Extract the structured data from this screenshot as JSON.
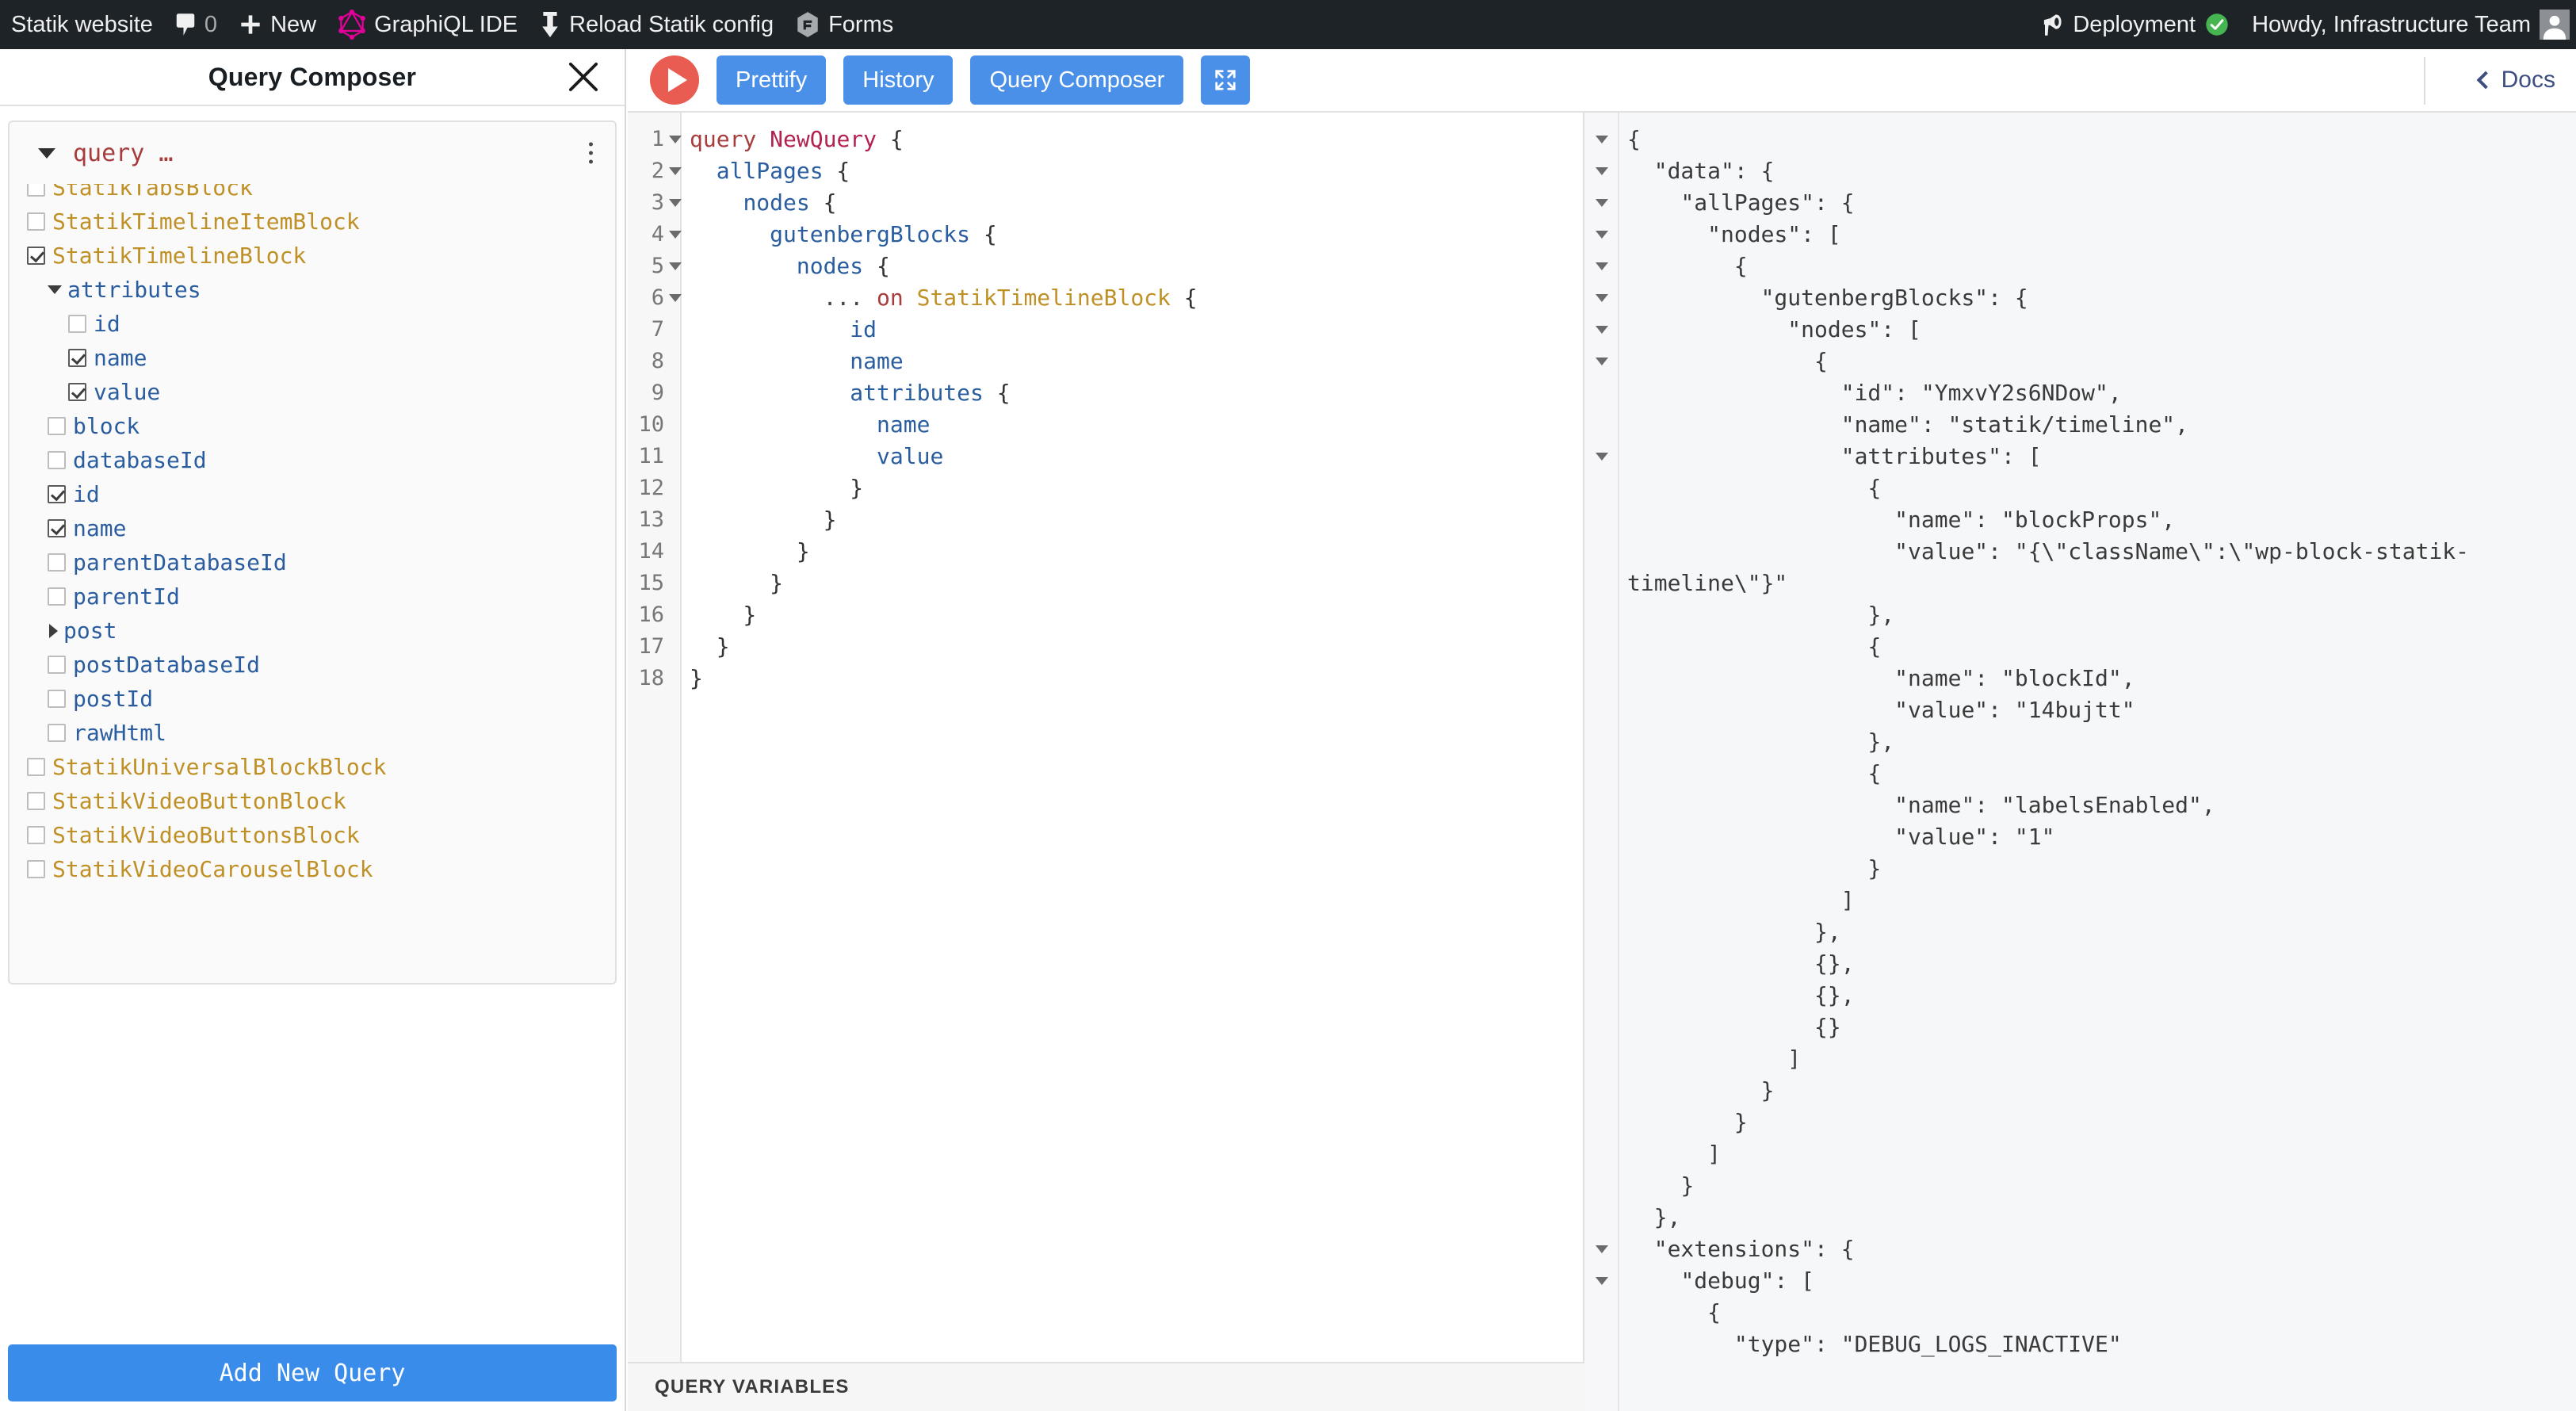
{
  "adminbar": {
    "site_name": "Statik website",
    "comments_icon": "comment-bubble-icon",
    "comments_count": "0",
    "new_icon": "plus-icon",
    "new_label": "New",
    "graphiql_icon": "graphql-logo-icon",
    "graphiql_label": "GraphiQL IDE",
    "reload_icon": "download-arrow-icon",
    "reload_label": "Reload Statik config",
    "forms_icon": "gravity-forms-icon",
    "forms_label": "Forms",
    "deployment_icon": "megaphone-icon",
    "deployment_label": "Deployment",
    "deployment_status_icon": "check-circle-icon",
    "howdy_label": "Howdy, Infrastructure Team",
    "avatar": "user-avatar"
  },
  "composer": {
    "title": "Query Composer",
    "close_icon": "close-icon",
    "query_operation_name": "query …",
    "kebab_icon": "more-options-icon",
    "add_new_query_label": "Add New Query",
    "tree": [
      {
        "label": "StatikTabsBlock",
        "kind": "type",
        "indent": 0,
        "checked": false,
        "clipped": true
      },
      {
        "label": "StatikTimelineItemBlock",
        "kind": "type",
        "indent": 0,
        "checked": false
      },
      {
        "label": "StatikTimelineBlock",
        "kind": "type",
        "indent": 0,
        "checked": true
      },
      {
        "label": "attributes",
        "kind": "field",
        "indent": 1,
        "toggle": "down"
      },
      {
        "label": "id",
        "kind": "field",
        "indent": 2,
        "checked": false
      },
      {
        "label": "name",
        "kind": "field",
        "indent": 2,
        "checked": true
      },
      {
        "label": "value",
        "kind": "field",
        "indent": 2,
        "checked": true
      },
      {
        "label": "block",
        "kind": "field",
        "indent": 1,
        "checked": false
      },
      {
        "label": "databaseId",
        "kind": "field",
        "indent": 1,
        "checked": false
      },
      {
        "label": "id",
        "kind": "field",
        "indent": 1,
        "checked": true
      },
      {
        "label": "name",
        "kind": "field",
        "indent": 1,
        "checked": true
      },
      {
        "label": "parentDatabaseId",
        "kind": "field",
        "indent": 1,
        "checked": false
      },
      {
        "label": "parentId",
        "kind": "field",
        "indent": 1,
        "checked": false
      },
      {
        "label": "post",
        "kind": "field",
        "indent": 1,
        "toggle": "right"
      },
      {
        "label": "postDatabaseId",
        "kind": "field",
        "indent": 1,
        "checked": false
      },
      {
        "label": "postId",
        "kind": "field",
        "indent": 1,
        "checked": false
      },
      {
        "label": "rawHtml",
        "kind": "field",
        "indent": 1,
        "checked": false
      },
      {
        "label": "StatikUniversalBlockBlock",
        "kind": "type",
        "indent": 0,
        "checked": false
      },
      {
        "label": "StatikVideoButtonBlock",
        "kind": "type",
        "indent": 0,
        "checked": false
      },
      {
        "label": "StatikVideoButtonsBlock",
        "kind": "type",
        "indent": 0,
        "checked": false
      },
      {
        "label": "StatikVideoCarouselBlock",
        "kind": "type",
        "indent": 0,
        "checked": false,
        "clipped": true
      }
    ]
  },
  "toolbar": {
    "execute_icon": "play-icon",
    "prettify_label": "Prettify",
    "history_label": "History",
    "query_composer_label": "Query Composer",
    "fullscreen_icon": "expand-icon",
    "docs_label": "Docs",
    "docs_chevron_icon": "chevron-left-icon"
  },
  "editor": {
    "lines": [
      {
        "n": 1,
        "fold": true,
        "text": "query NewQuery {"
      },
      {
        "n": 2,
        "fold": true,
        "text": "  allPages {"
      },
      {
        "n": 3,
        "fold": true,
        "text": "    nodes {"
      },
      {
        "n": 4,
        "fold": true,
        "text": "      gutenbergBlocks {"
      },
      {
        "n": 5,
        "fold": true,
        "text": "        nodes {"
      },
      {
        "n": 6,
        "fold": true,
        "text": "          ... on StatikTimelineBlock {"
      },
      {
        "n": 7,
        "fold": false,
        "text": "            id"
      },
      {
        "n": 8,
        "fold": false,
        "text": "            name"
      },
      {
        "n": 9,
        "fold": false,
        "text": "            attributes {"
      },
      {
        "n": 10,
        "fold": false,
        "text": "              name"
      },
      {
        "n": 11,
        "fold": false,
        "text": "              value"
      },
      {
        "n": 12,
        "fold": false,
        "text": "            }"
      },
      {
        "n": 13,
        "fold": false,
        "text": "          }"
      },
      {
        "n": 14,
        "fold": false,
        "text": "        }"
      },
      {
        "n": 15,
        "fold": false,
        "text": "      }"
      },
      {
        "n": 16,
        "fold": false,
        "text": "    }"
      },
      {
        "n": 17,
        "fold": false,
        "text": "  }"
      },
      {
        "n": 18,
        "fold": false,
        "text": "}"
      }
    ],
    "query_variables_label": "QUERY VARIABLES"
  },
  "result": {
    "lines": [
      {
        "fold": true,
        "text": "{"
      },
      {
        "fold": true,
        "text": "  \"data\": {"
      },
      {
        "fold": true,
        "text": "    \"allPages\": {"
      },
      {
        "fold": true,
        "text": "      \"nodes\": ["
      },
      {
        "fold": true,
        "text": "        {"
      },
      {
        "fold": true,
        "text": "          \"gutenbergBlocks\": {"
      },
      {
        "fold": true,
        "text": "            \"nodes\": ["
      },
      {
        "fold": true,
        "text": "              {"
      },
      {
        "fold": false,
        "text": "                \"id\": \"YmxvY2s6NDow\","
      },
      {
        "fold": false,
        "text": "                \"name\": \"statik/timeline\","
      },
      {
        "fold": true,
        "text": "                \"attributes\": ["
      },
      {
        "fold": false,
        "text": "                  {"
      },
      {
        "fold": false,
        "text": "                    \"name\": \"blockProps\","
      },
      {
        "fold": false,
        "text": "                    \"value\": \"{\\\"className\\\":\\\"wp-block-statik-timeline\\\"}\""
      },
      {
        "fold": false,
        "text": "                  },"
      },
      {
        "fold": false,
        "text": "                  {"
      },
      {
        "fold": false,
        "text": "                    \"name\": \"blockId\","
      },
      {
        "fold": false,
        "text": "                    \"value\": \"14bujtt\""
      },
      {
        "fold": false,
        "text": "                  },"
      },
      {
        "fold": false,
        "text": "                  {"
      },
      {
        "fold": false,
        "text": "                    \"name\": \"labelsEnabled\","
      },
      {
        "fold": false,
        "text": "                    \"value\": \"1\""
      },
      {
        "fold": false,
        "text": "                  }"
      },
      {
        "fold": false,
        "text": "                ]"
      },
      {
        "fold": false,
        "text": "              },"
      },
      {
        "fold": false,
        "text": "              {},"
      },
      {
        "fold": false,
        "text": "              {},"
      },
      {
        "fold": false,
        "text": "              {}"
      },
      {
        "fold": false,
        "text": "            ]"
      },
      {
        "fold": false,
        "text": "          }"
      },
      {
        "fold": false,
        "text": "        }"
      },
      {
        "fold": false,
        "text": "      ]"
      },
      {
        "fold": false,
        "text": "    }"
      },
      {
        "fold": false,
        "text": "  },"
      },
      {
        "fold": true,
        "text": "  \"extensions\": {"
      },
      {
        "fold": true,
        "text": "    \"debug\": ["
      },
      {
        "fold": false,
        "text": "      {"
      },
      {
        "fold": false,
        "text": "        \"type\": \"DEBUG_LOGS_INACTIVE\""
      }
    ]
  },
  "colors": {
    "adminbar_bg": "#1d2327",
    "accent_blue": "#4a90e8",
    "execute_red": "#e85c52",
    "graphql_pink": "#e10098",
    "status_green": "#46b450",
    "token_type": "#bf9026",
    "token_field": "#2a5d9f",
    "token_string": "#c13b7c",
    "token_keyword": "#b3214f"
  }
}
